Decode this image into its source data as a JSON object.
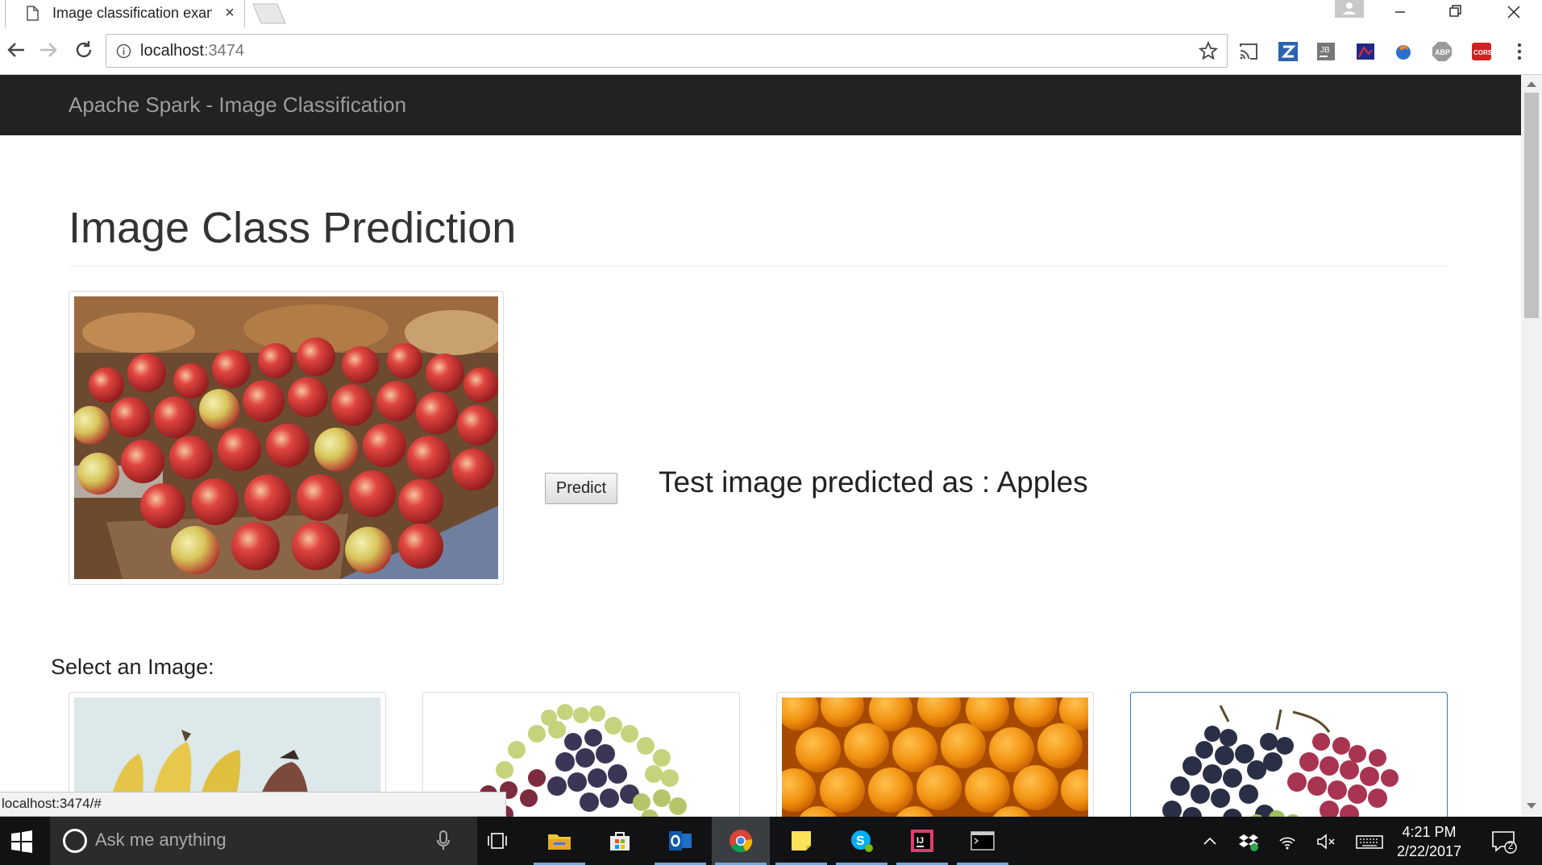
{
  "browser": {
    "tab_title": "Image classification exan",
    "tab_close": "×",
    "url_host": "localhost",
    "url_port": ":3474",
    "status_url": "localhost:3474/#"
  },
  "navbar": {
    "brand": "Apache Spark - Image Classification"
  },
  "main": {
    "title": "Image Class Prediction",
    "predict_button": "Predict",
    "prediction_text": "Test image predicted as : Apples",
    "select_label": "Select an Image:"
  },
  "thumbnails": [
    {
      "subject": "bananas"
    },
    {
      "subject": "grapes-mixed"
    },
    {
      "subject": "oranges"
    },
    {
      "subject": "grapes-dark-red"
    }
  ],
  "taskbar": {
    "search_placeholder": "Ask me anything",
    "time": "4:21 PM",
    "date": "2/22/2017",
    "notification_count": "2"
  },
  "colors": {
    "navbar_bg": "#222222",
    "navbar_text": "#9d9d9d",
    "active_thumb_border": "#337ab7",
    "taskbar_bg": "#101214"
  }
}
